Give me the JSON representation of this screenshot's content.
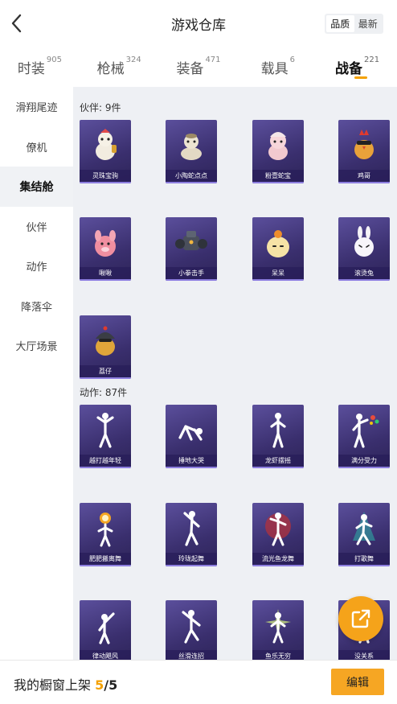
{
  "header": {
    "title": "游戏仓库",
    "back_icon": "chevron-left-icon",
    "sort_options": [
      "品质",
      "最新"
    ],
    "sort_selected": "品质"
  },
  "tabs": [
    {
      "label": "时装",
      "count": "905"
    },
    {
      "label": "枪械",
      "count": "324"
    },
    {
      "label": "装备",
      "count": "471"
    },
    {
      "label": "载具",
      "count": "6"
    },
    {
      "label": "战备",
      "count": "221"
    }
  ],
  "active_tab": "战备",
  "sidebar": {
    "items": [
      "滑翔尾迹",
      "僚机",
      "集结舱",
      "伙伴",
      "动作",
      "降落伞",
      "大厅场景"
    ],
    "active": "集结舱"
  },
  "sections": {
    "partners": {
      "title": "伙伴: 9件",
      "items": [
        "灵珠宝驹",
        "小陶蛇点点",
        "粉壹蛇宝",
        "鸡哥",
        "啾啾",
        "小拳击手",
        "呆呆",
        "滚烫兔",
        "荔仔"
      ]
    },
    "emotes": {
      "title": "动作: 87件",
      "items": [
        "越打越年轻",
        "捶地大哭",
        "龙虾摆摇",
        "满分受力",
        "肥肥搬离舞",
        "玲珑起舞",
        "流光鱼龙舞",
        "打歌舞",
        "律动飓风",
        "丝滑连招",
        "鱼乐无穷",
        "没关系"
      ]
    }
  },
  "fab": {
    "icon": "share-external-icon"
  },
  "bottombar": {
    "label": "我的橱窗上架",
    "count": "5",
    "total": "/5",
    "edit_label": "编辑"
  },
  "colors": {
    "accent": "#f4a100",
    "card_bg": "#3a2f6e",
    "content_bg": "#eef0f4"
  }
}
